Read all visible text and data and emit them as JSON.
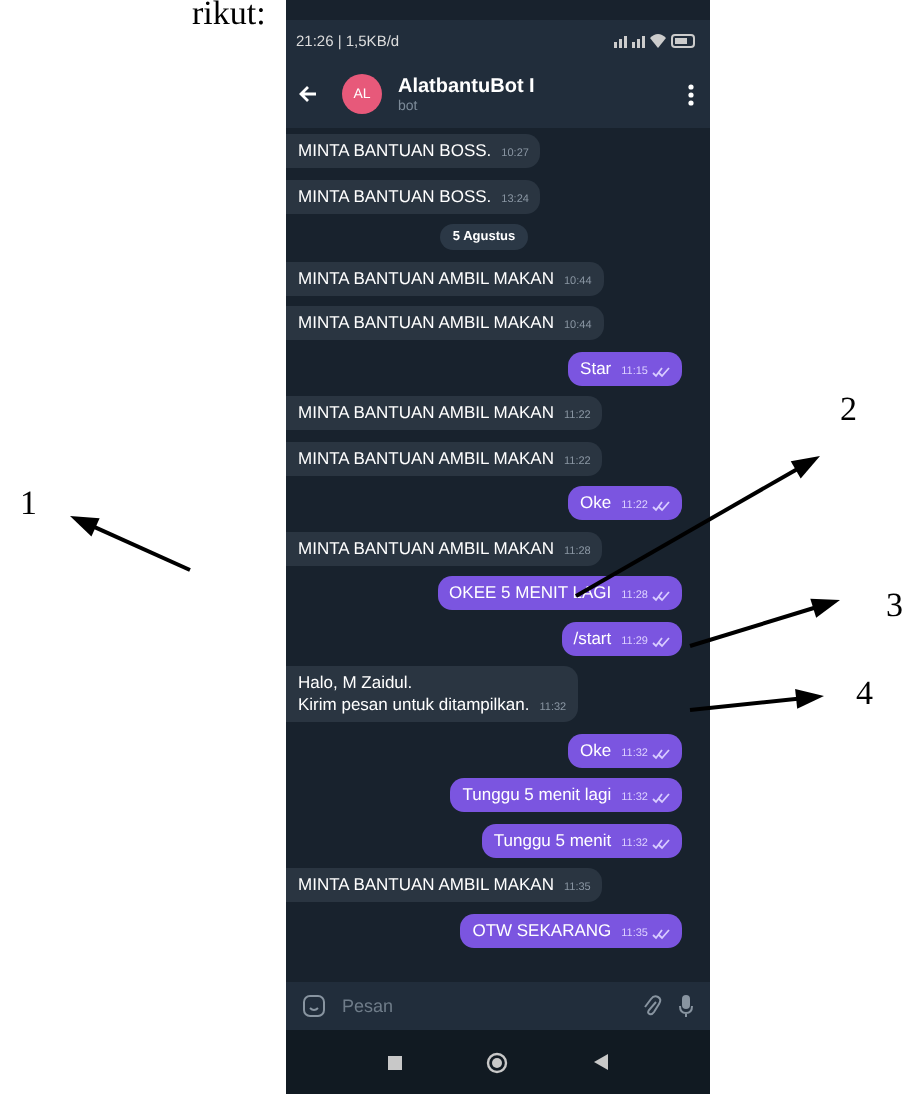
{
  "document": {
    "text": "rikut:"
  },
  "status_bar": {
    "time": "21:26 | 1,5KB/d"
  },
  "chat": {
    "avatar": "AL",
    "title": "AlatbantuBot I",
    "subtitle": "bot"
  },
  "messages": [
    {
      "kind": "in",
      "lines": [
        "MINTA BANTUAN BOSS."
      ],
      "time": "10:27"
    },
    {
      "kind": "in",
      "lines": [
        "MINTA BANTUAN BOSS."
      ],
      "time": "13:24"
    },
    {
      "kind": "date",
      "lines": [
        "5 Agustus"
      ]
    },
    {
      "kind": "in",
      "lines": [
        "MINTA BANTUAN AMBIL MAKAN"
      ],
      "time": "10:44"
    },
    {
      "kind": "in",
      "lines": [
        "MINTA BANTUAN AMBIL MAKAN"
      ],
      "time": "10:44"
    },
    {
      "kind": "out",
      "lines": [
        "Star"
      ],
      "time": "11:15"
    },
    {
      "kind": "in",
      "lines": [
        "MINTA BANTUAN AMBIL MAKAN"
      ],
      "time": "11:22"
    },
    {
      "kind": "in",
      "lines": [
        "MINTA BANTUAN AMBIL MAKAN"
      ],
      "time": "11:22"
    },
    {
      "kind": "out",
      "lines": [
        "Oke"
      ],
      "time": "11:22"
    },
    {
      "kind": "in",
      "lines": [
        "MINTA BANTUAN AMBIL MAKAN"
      ],
      "time": "11:28"
    },
    {
      "kind": "out",
      "lines": [
        "OKEE 5 MENIT LAGI"
      ],
      "time": "11:28"
    },
    {
      "kind": "out",
      "lines": [
        "/start"
      ],
      "time": "11:29"
    },
    {
      "kind": "in",
      "lines": [
        "Halo, M Zaidul.",
        "Kirim pesan untuk ditampilkan."
      ],
      "time": "11:32"
    },
    {
      "kind": "out",
      "lines": [
        "Oke"
      ],
      "time": "11:32"
    },
    {
      "kind": "out",
      "lines": [
        "Tunggu 5 menit lagi"
      ],
      "time": "11:32"
    },
    {
      "kind": "out",
      "lines": [
        "Tunggu 5 menit"
      ],
      "time": "11:32"
    },
    {
      "kind": "in",
      "lines": [
        "MINTA BANTUAN AMBIL MAKAN"
      ],
      "time": "11:35"
    },
    {
      "kind": "out",
      "lines": [
        "OTW SEKARANG"
      ],
      "time": "11:35"
    }
  ],
  "composer": {
    "placeholder": "Pesan"
  },
  "annotations": [
    {
      "label": "1"
    },
    {
      "label": "2"
    },
    {
      "label": "3"
    },
    {
      "label": "4"
    }
  ]
}
